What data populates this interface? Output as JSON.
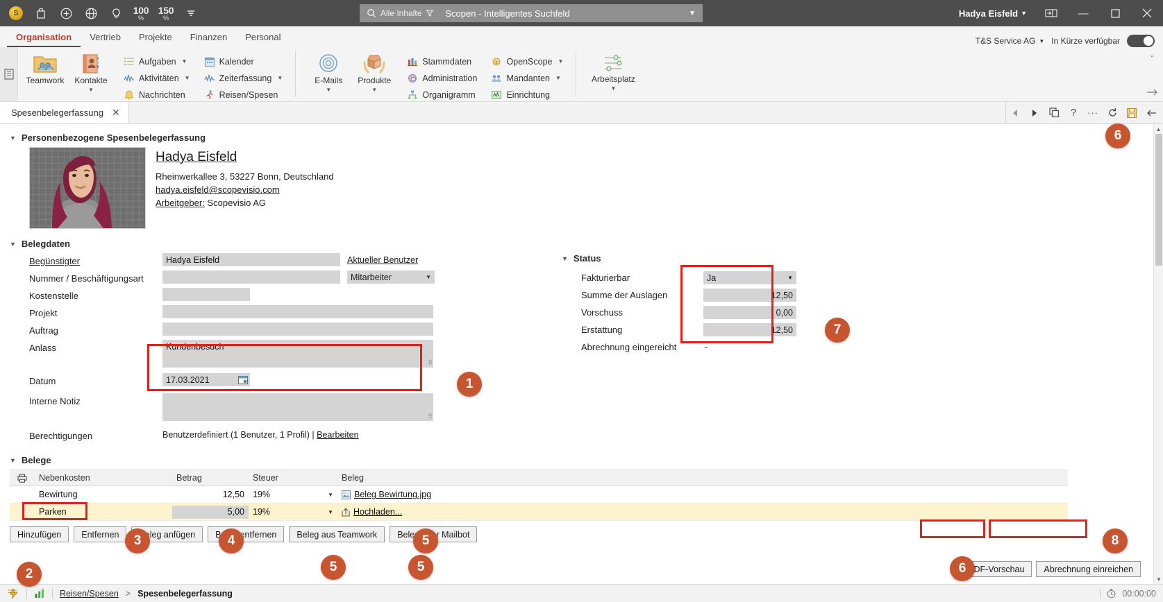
{
  "titlebar": {
    "icons": [
      "coin-icon",
      "bag-icon",
      "plus-circle-icon",
      "globe-icon",
      "bulb-icon"
    ],
    "zoom1": "100",
    "zoom1_unit": "%",
    "zoom2": "150",
    "zoom2_unit": "%",
    "overflow": "chevron-down-icon",
    "search_scope": "Alle Inhalte",
    "search_value": "Scopen - Intelligentes Suchfeld",
    "search_placeholder": "Scopen - Intelligentes Suchfeld",
    "user": "Hadya Eisfeld",
    "window_buttons": {
      "minimize": "—",
      "maximize": "▢",
      "close": "✕"
    }
  },
  "ribbon": {
    "tabs": [
      {
        "label": "Organisation",
        "active": true
      },
      {
        "label": "Vertrieb",
        "active": false
      },
      {
        "label": "Projekte",
        "active": false
      },
      {
        "label": "Finanzen",
        "active": false
      },
      {
        "label": "Personal",
        "active": false
      }
    ],
    "tenant": "T&S Service AG",
    "availability_label": "In Kürze verfügbar",
    "big_buttons": [
      {
        "label": "Teamwork",
        "icon": "teamwork-folder-icon",
        "has_dropdown": false
      },
      {
        "label": "Kontakte",
        "icon": "contacts-book-icon",
        "has_dropdown": true
      },
      {
        "label": "E-Mails",
        "icon": "at-sign-icon",
        "has_dropdown": true
      },
      {
        "label": "Produkte",
        "icon": "product-box-icon",
        "has_dropdown": true
      },
      {
        "label": "Arbeitsplatz",
        "icon": "sliders-icon",
        "has_dropdown": true
      }
    ],
    "col_group_1": [
      {
        "label": "Aufgaben",
        "icon": "tasks-icon",
        "has_dropdown": true
      },
      {
        "label": "Aktivitäten",
        "icon": "activities-icon",
        "has_dropdown": true
      },
      {
        "label": "Nachrichten",
        "icon": "bell-icon",
        "has_dropdown": false
      }
    ],
    "col_group_2": [
      {
        "label": "Kalender",
        "icon": "calendar-icon",
        "has_dropdown": false
      },
      {
        "label": "Zeiterfassung",
        "icon": "time-tracking-icon",
        "has_dropdown": true
      },
      {
        "label": "Reisen/Spesen",
        "icon": "travel-expense-icon",
        "has_dropdown": false
      }
    ],
    "col_group_3": [
      {
        "label": "Stammdaten",
        "icon": "master-data-icon",
        "has_dropdown": false
      },
      {
        "label": "Administration",
        "icon": "administration-icon",
        "has_dropdown": false
      },
      {
        "label": "Organigramm",
        "icon": "org-chart-icon",
        "has_dropdown": false
      }
    ],
    "col_group_4": [
      {
        "label": "OpenScope",
        "icon": "openscope-icon",
        "has_dropdown": true
      },
      {
        "label": "Mandanten",
        "icon": "clients-icon",
        "has_dropdown": true
      },
      {
        "label": "Einrichtung",
        "icon": "setup-icon",
        "has_dropdown": false
      }
    ]
  },
  "doctabs": {
    "tab_label": "Spesenbelegerfassung",
    "tools": [
      "back-arrow-icon",
      "forward-arrow-icon",
      "duplicate-icon",
      "help-icon",
      "more-icon",
      "refresh-icon",
      "save-icon",
      "collapse-left-icon"
    ]
  },
  "person_section": {
    "title": "Personenbezogene Spesenbelegerfassung",
    "name": "Hadya Eisfeld",
    "address": "Rheinwerkallee 3, 53227 Bonn, Deutschland",
    "email": "hadya.eisfeld@scopevisio.com",
    "employer_label": "Arbeitgeber:",
    "employer_value": "Scopevisio AG",
    "photo_alt": "avatar-photo"
  },
  "belegdaten": {
    "title": "Belegdaten",
    "fields": [
      {
        "label": "Begünstigter",
        "value": "Hadya Eisfeld",
        "link": "Aktueller Benutzer"
      },
      {
        "label": "Nummer / Beschäftigungsart",
        "value": "",
        "select": "Mitarbeiter"
      },
      {
        "label": "Kostenstelle",
        "value": ""
      },
      {
        "label": "Projekt",
        "value": ""
      },
      {
        "label": "Auftrag",
        "value": ""
      },
      {
        "label": "Anlass",
        "value": "Kundenbesuch"
      },
      {
        "label": "Datum",
        "value": "17.03.2021"
      },
      {
        "label": "Interne Notiz",
        "value": ""
      }
    ],
    "permissions_label": "Berechtigungen",
    "permissions_value": "Benutzerdefiniert (1 Benutzer, 1 Profil) |",
    "permissions_link": "Bearbeiten"
  },
  "status_section": {
    "title": "Status",
    "rows": [
      {
        "label": "Fakturierbar",
        "value": "Ja",
        "type": "select"
      },
      {
        "label": "Summe der Auslagen",
        "value": "12,50",
        "type": "amount"
      },
      {
        "label": "Vorschuss",
        "value": "0,00",
        "type": "amount"
      },
      {
        "label": "Erstattung",
        "value": "12,50",
        "type": "amount"
      },
      {
        "label": "Abrechnung eingereicht",
        "value": "-",
        "type": "text"
      }
    ]
  },
  "belege_section": {
    "title": "Belege",
    "columns": [
      "",
      "Nebenkosten",
      "Betrag",
      "Steuer",
      "Beleg"
    ],
    "rows": [
      {
        "name": "Bewirtung",
        "amount": "12,50",
        "tax": "19%",
        "doc": "Beleg Bewirtung.jpg",
        "doc_icon": "image-file-icon",
        "selected": false
      },
      {
        "name": "Parken",
        "amount": "5,00",
        "tax": "19%",
        "doc": "Hochladen...",
        "doc_icon": "upload-icon",
        "selected": true
      }
    ],
    "buttons": [
      "Hinzufügen",
      "Entfernen",
      "Beleg anfügen",
      "Beleg entfernen",
      "Beleg aus Teamwork",
      "Beleg über Mailbot"
    ]
  },
  "footer_buttons": [
    "PDF-Vorschau",
    "Abrechnung einreichen"
  ],
  "statusbar": {
    "breadcrumb_link": "Reisen/Spesen",
    "breadcrumb_sep": ">",
    "breadcrumb_current": "Spesenbelegerfassung",
    "timer": "00:00:00",
    "icons": [
      "lightning-icon",
      "chart-icon",
      "stopwatch-icon"
    ]
  },
  "annotations": {
    "badges": [
      "1",
      "2",
      "3",
      "4",
      "5",
      "5",
      "5",
      "6",
      "6",
      "7",
      "8"
    ]
  },
  "colors": {
    "accent_red": "#c0392b",
    "highlight_red": "#e32119",
    "badge": "#c75530",
    "titlebar": "#4d4d4d",
    "field": "#d4d4d4",
    "row_selected": "#fdf3cf"
  }
}
